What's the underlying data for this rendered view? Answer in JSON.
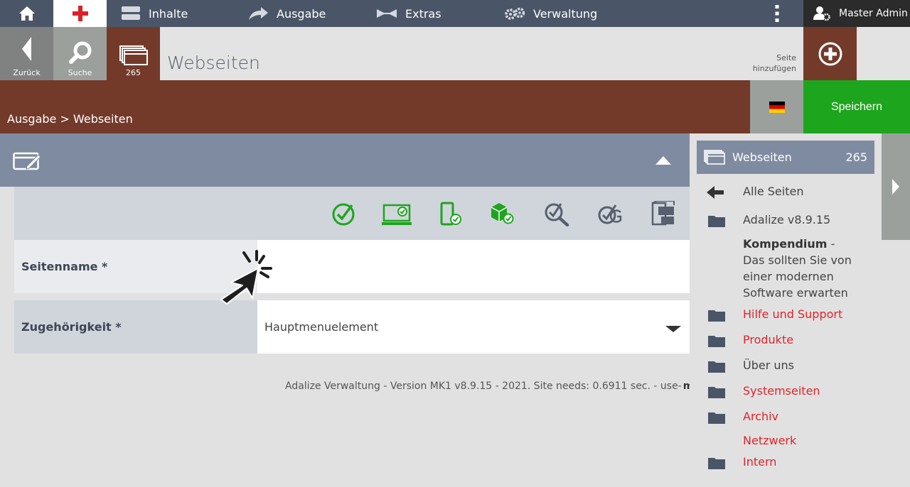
{
  "nav": {
    "items": [
      "Inhalte",
      "Ausgabe",
      "Extras",
      "Verwaltung"
    ],
    "user": "Master Admin"
  },
  "toolbar": {
    "back_label": "Zurück",
    "search_label": "Suche",
    "pages_count": "265",
    "title": "Webseiten",
    "add_label_1": "Seite",
    "add_label_2": "hinzufügen"
  },
  "breadcrumb": "Ausgabe > Webseiten",
  "save_label": "Speichern",
  "form": {
    "seitenname_label": "Seitenname *",
    "zugehoerigkeit_label": "Zugehörigkeit *",
    "zugehoerigkeit_value": "Hauptmenuelement"
  },
  "footer": {
    "text": "Adalize Verwaltung - Version MK1 v8.9.15 - 2021. Site needs: 0.6911 sec. - use-",
    "brand": "media"
  },
  "sidebar": {
    "header_title": "Webseiten",
    "header_count": "265",
    "all_pages": "Alle Seiten",
    "adalize": "Adalize v8.9.15",
    "kompendium_title": "Kompendium",
    "kompendium_rest": "Das sollten Sie von einer modernen Software erwarten",
    "hilfe": "Hilfe und Support",
    "produkte": "Produkte",
    "ueber": "Über uns",
    "systemseiten": "Systemseiten",
    "archiv": "Archiv",
    "netzwerk": "Netzwerk",
    "intern": "Intern"
  },
  "colors": {
    "nav_bg": "#4a5668",
    "accent_brown": "#733a2a",
    "save_green": "#1ea51e",
    "section_blue": "#7f8ba0",
    "link_red": "#e0242c"
  }
}
